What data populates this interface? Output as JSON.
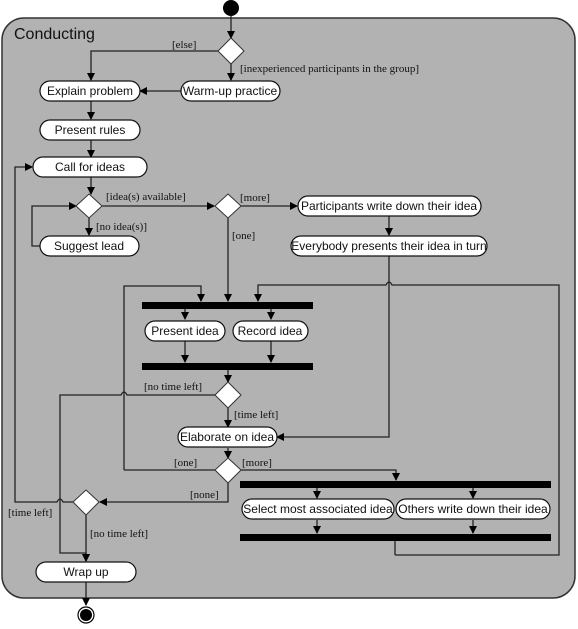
{
  "diagram": {
    "type": "uml-activity",
    "title": "Conducting",
    "activities": [
      {
        "id": "explain",
        "label": "Explain problem"
      },
      {
        "id": "warmup",
        "label": "Warm-up practice"
      },
      {
        "id": "rules",
        "label": "Present rules"
      },
      {
        "id": "call",
        "label": "Call for ideas"
      },
      {
        "id": "lead",
        "label": "Suggest lead"
      },
      {
        "id": "pwrite",
        "label": "Participants write down their idea"
      },
      {
        "id": "everybody",
        "label": "Everybody presents their idea in turn"
      },
      {
        "id": "present",
        "label": "Present idea"
      },
      {
        "id": "record",
        "label": "Record idea"
      },
      {
        "id": "elaborate",
        "label": "Elaborate on idea"
      },
      {
        "id": "select",
        "label": "Select most associated idea"
      },
      {
        "id": "others",
        "label": "Others write down their idea"
      },
      {
        "id": "wrap",
        "label": "Wrap up"
      }
    ],
    "guards": {
      "else": "[else]",
      "inexperienced": "[inexperienced participants in the group]",
      "ideas_available": "[idea(s) available]",
      "no_ideas": "[no idea(s)]",
      "more1": "[more]",
      "one1": "[one]",
      "no_time_left1": "[no time left]",
      "time_left1": "[time left]",
      "one2": "[one]",
      "more2": "[more]",
      "none": "[none]",
      "time_left2": "[time left]",
      "no_time_left2": "[no time left]"
    }
  }
}
